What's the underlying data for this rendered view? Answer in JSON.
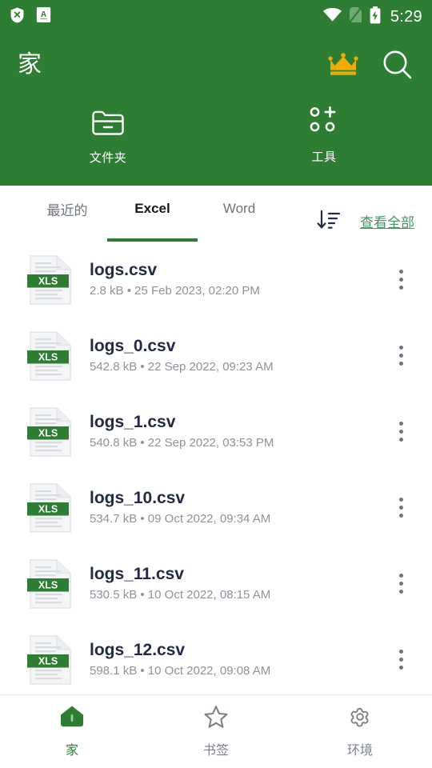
{
  "statusbar": {
    "time": "5:29",
    "icons": [
      "shield-x-icon",
      "a-box-icon",
      "wifi-icon",
      "sim-off-icon",
      "battery-charging-icon"
    ]
  },
  "header": {
    "title": "家",
    "background_color": "#2d7d32",
    "crown_icon": "crown-icon",
    "crown_color": "#f0ab00",
    "search_icon": "search-icon",
    "quick_actions": [
      {
        "label": "文件夹",
        "icon": "folder-icon"
      },
      {
        "label": "工具",
        "icon": "tools-grid-plus-icon"
      }
    ]
  },
  "tabs": {
    "items": [
      {
        "label": "最近的",
        "active": false
      },
      {
        "label": "Excel",
        "active": true
      },
      {
        "label": "Word",
        "active": false
      }
    ],
    "sort_icon": "sort-descending-icon",
    "view_all_label": "查看全部",
    "view_all_color": "#489167",
    "active_underline_color": "#2d7d32"
  },
  "files": [
    {
      "name": "logs.csv",
      "size": "2.8 kB",
      "separator": "•",
      "date": "25 Feb 2023, 02:20 PM",
      "type_badge": "XLS"
    },
    {
      "name": "logs_0.csv",
      "size": "542.8 kB",
      "separator": "•",
      "date": "22 Sep 2022, 09:23 AM",
      "type_badge": "XLS"
    },
    {
      "name": "logs_1.csv",
      "size": "540.8 kB",
      "separator": "•",
      "date": "22 Sep 2022, 03:53 PM",
      "type_badge": "XLS"
    },
    {
      "name": "logs_10.csv",
      "size": "534.7 kB",
      "separator": "•",
      "date": "09 Oct 2022, 09:34 AM",
      "type_badge": "XLS"
    },
    {
      "name": "logs_11.csv",
      "size": "530.5 kB",
      "separator": "•",
      "date": "10 Oct 2022, 08:15 AM",
      "type_badge": "XLS"
    },
    {
      "name": "logs_12.csv",
      "size": "598.1 kB",
      "separator": "•",
      "date": "10 Oct 2022, 09:08 AM",
      "type_badge": "XLS"
    }
  ],
  "file_meta_text": [
    "2.8 kB • 25 Feb 2023, 02:20 PM",
    "542.8 kB • 22 Sep 2022, 09:23 AM",
    "540.8 kB • 22 Sep 2022, 03:53 PM",
    "534.7 kB • 09 Oct 2022, 09:34 AM",
    "530.5 kB • 10 Oct 2022, 08:15 AM",
    "598.1 kB • 10 Oct 2022, 09:08 AM"
  ],
  "bottom_nav": {
    "items": [
      {
        "label": "家",
        "icon": "home-icon",
        "active": true
      },
      {
        "label": "书签",
        "icon": "star-icon",
        "active": false
      },
      {
        "label": "环境",
        "icon": "gear-icon",
        "active": false
      }
    ],
    "active_color": "#2d7d32",
    "inactive_color": "#7b818c"
  }
}
